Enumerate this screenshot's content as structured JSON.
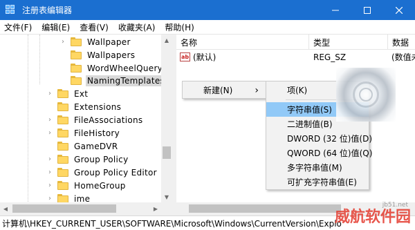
{
  "window": {
    "title": "注册表编辑器",
    "controls": {
      "minimize": "minimize-icon",
      "maximize": "maximize-icon",
      "close": "close-icon"
    }
  },
  "menubar": [
    {
      "label": "文件(F)"
    },
    {
      "label": "编辑(E)"
    },
    {
      "label": "查看(V)"
    },
    {
      "label": "收藏夹(A)"
    },
    {
      "label": "帮助(H)"
    }
  ],
  "tree": {
    "items": [
      {
        "label": "Wallpaper",
        "level": 2,
        "expander": "chevron-right"
      },
      {
        "label": "Wallpapers",
        "level": 2,
        "expander": "none"
      },
      {
        "label": "WordWheelQuery",
        "level": 2,
        "expander": "none"
      },
      {
        "label": "NamingTemplates",
        "level": 2,
        "expander": "none",
        "selected": true
      },
      {
        "label": "Ext",
        "level": 1,
        "expander": "chevron-right"
      },
      {
        "label": "Extensions",
        "level": 1,
        "expander": "none"
      },
      {
        "label": "FileAssociations",
        "level": 1,
        "expander": "chevron-right"
      },
      {
        "label": "FileHistory",
        "level": 1,
        "expander": "chevron-right"
      },
      {
        "label": "GameDVR",
        "level": 1,
        "expander": "none"
      },
      {
        "label": "Group Policy",
        "level": 1,
        "expander": "chevron-right"
      },
      {
        "label": "Group Policy Editor",
        "level": 1,
        "expander": "chevron-right"
      },
      {
        "label": "HomeGroup",
        "level": 1,
        "expander": "chevron-right"
      },
      {
        "label": "ime",
        "level": 1,
        "expander": "chevron-right"
      }
    ]
  },
  "list": {
    "columns": [
      {
        "label": "名称"
      },
      {
        "label": "类型"
      },
      {
        "label": "数据"
      }
    ],
    "rows": [
      {
        "icon": "string-value-icon",
        "icon_text": "ab",
        "name": "(默认)",
        "type": "REG_SZ",
        "data": "(数值未"
      }
    ]
  },
  "context_menu": {
    "new_label": "新建(N)",
    "new_arrow": "›"
  },
  "submenu": {
    "items": [
      {
        "label": "项(K)"
      },
      {
        "label": "字符串值(S)",
        "highlighted": true
      },
      {
        "label": "二进制值(B)"
      },
      {
        "label": "DWORD (32 位)值(D)"
      },
      {
        "label": "QWORD (64 位)值(Q)"
      },
      {
        "label": "多字符串值(M)"
      },
      {
        "label": "可扩充字符串值(E)"
      }
    ]
  },
  "statusbar": {
    "path": "计算机\\HKEY_CURRENT_USER\\SOFTWARE\\Microsoft\\Windows\\CurrentVersion\\Explo"
  },
  "watermark": {
    "text": "威航软件园",
    "url": "jb51.net"
  },
  "colors": {
    "titlebar": "#1b6fd0",
    "highlight": "#91c9f7",
    "folder": "#ffd763",
    "watermark": "#e43a2e"
  }
}
